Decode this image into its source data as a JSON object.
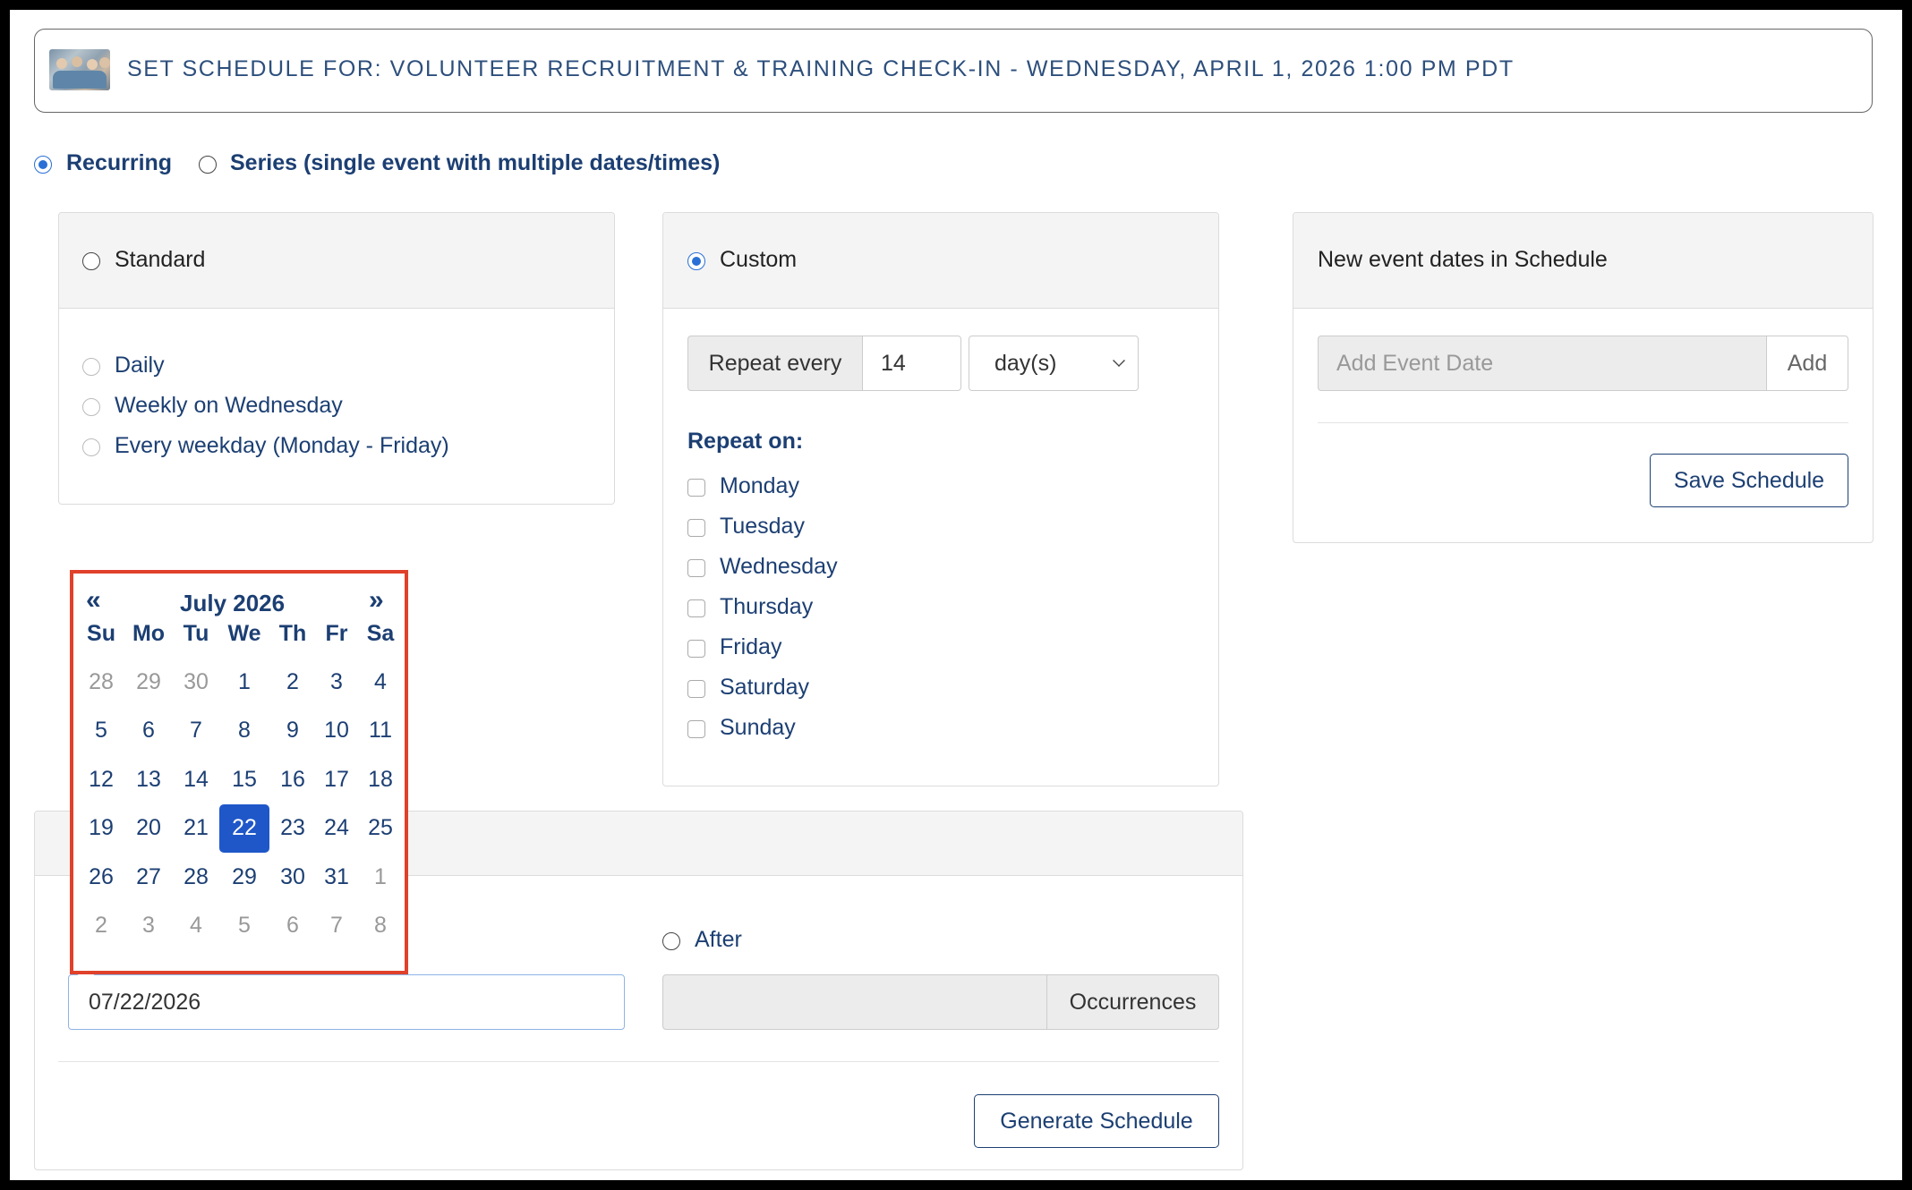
{
  "header": {
    "title": "SET SCHEDULE FOR: VOLUNTEER RECRUITMENT & TRAINING CHECK-IN - WEDNESDAY, APRIL 1, 2026 1:00 PM PDT"
  },
  "mode": {
    "recurring_label": "Recurring",
    "series_label": "Series (single event with multiple dates/times)",
    "selected": "Recurring"
  },
  "standard": {
    "label": "Standard",
    "options": [
      "Daily",
      "Weekly on Wednesday",
      "Every weekday (Monday - Friday)"
    ]
  },
  "custom": {
    "label": "Custom",
    "repeat_every_label": "Repeat every",
    "repeat_every_value": "14",
    "unit_value": "day(s)",
    "repeat_on_label": "Repeat on:",
    "days": [
      "Monday",
      "Tuesday",
      "Wednesday",
      "Thursday",
      "Friday",
      "Saturday",
      "Sunday"
    ]
  },
  "new_dates": {
    "title": "New event dates in Schedule",
    "add_placeholder": "Add Event Date",
    "add_label": "Add",
    "save_label": "Save Schedule"
  },
  "datepicker": {
    "month_label": "July 2026",
    "prev_label": "«",
    "next_label": "»",
    "weekdays": [
      "Su",
      "Mo",
      "Tu",
      "We",
      "Th",
      "Fr",
      "Sa"
    ],
    "weeks": [
      [
        "28",
        "29",
        "30",
        "1",
        "2",
        "3",
        "4"
      ],
      [
        "5",
        "6",
        "7",
        "8",
        "9",
        "10",
        "11"
      ],
      [
        "12",
        "13",
        "14",
        "15",
        "16",
        "17",
        "18"
      ],
      [
        "19",
        "20",
        "21",
        "22",
        "23",
        "24",
        "25"
      ],
      [
        "26",
        "27",
        "28",
        "29",
        "30",
        "31",
        "1"
      ],
      [
        "2",
        "3",
        "4",
        "5",
        "6",
        "7",
        "8"
      ]
    ],
    "selected_day": "22",
    "colors": {
      "selected_bg": "#1f57c9",
      "highlight_border": "#e0412b"
    }
  },
  "end": {
    "date_value": "07/22/2026",
    "after_label": "After",
    "occurrences_label": "Occurrences",
    "generate_label": "Generate Schedule"
  }
}
